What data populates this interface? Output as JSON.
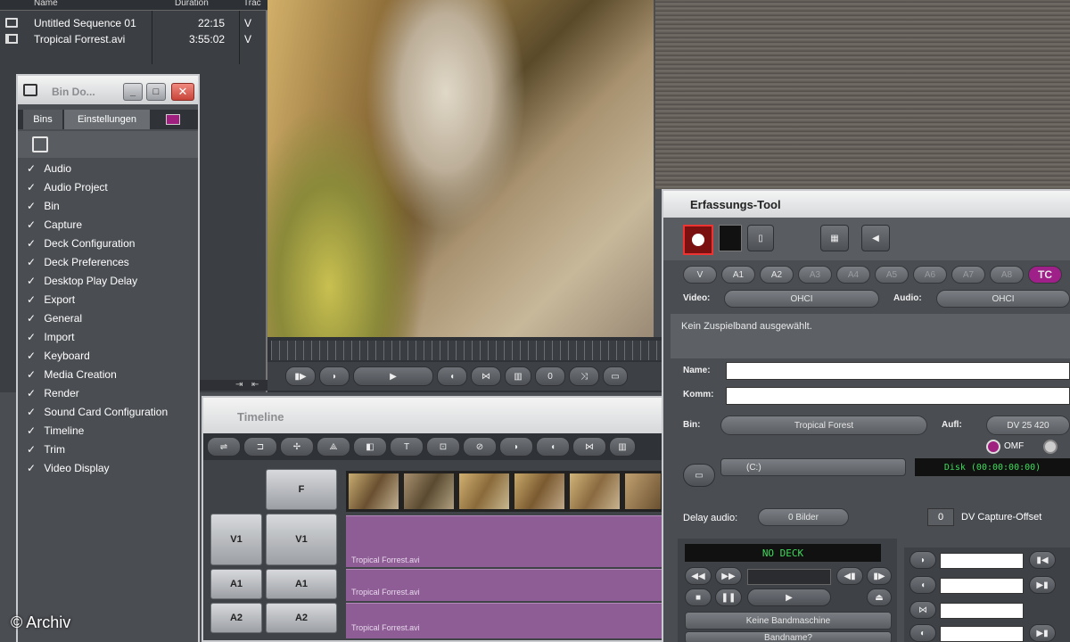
{
  "bin": {
    "col_name": "Name",
    "col_duration": "Duration",
    "col_tracks": "Trac",
    "rows": [
      {
        "name": "Untitled Sequence 01",
        "duration": "22:15",
        "track": "V"
      },
      {
        "name": "Tropical Forrest.avi",
        "duration": "3:55:02",
        "track": "V"
      }
    ]
  },
  "settings": {
    "title": "Bin Do...",
    "tabs": [
      "Bins",
      "Einstellungen"
    ],
    "items": [
      "Audio",
      "Audio Project",
      "Bin",
      "Capture",
      "Deck Configuration",
      "Deck Preferences",
      "Desktop Play Delay",
      "Export",
      "General",
      "Import",
      "Keyboard",
      "Media Creation",
      "Render",
      "Sound Card Configuration",
      "Timeline",
      "Trim",
      "Video Display"
    ]
  },
  "player": {
    "counter": "0"
  },
  "timeline": {
    "title": "Timeline",
    "tracks_src": [
      "V1",
      "A1",
      "A2"
    ],
    "tracks_rec": [
      "V1",
      "A1",
      "A2"
    ],
    "top_label": "F",
    "clip_label": "Tropical Forrest.avi"
  },
  "capture": {
    "title": "Erfassungs-Tool",
    "tracks": [
      "V",
      "A1",
      "A2",
      "A3",
      "A4",
      "A5",
      "A6",
      "A7",
      "A8"
    ],
    "tc": "TC",
    "video_label": "Video:",
    "video_value": "OHCI",
    "audio_label": "Audio:",
    "audio_value": "OHCI",
    "message": "Kein Zuspielband ausgewählt.",
    "name_label": "Name:",
    "comment_label": "Komm:",
    "bin_label": "Bin:",
    "bin_value": "Tropical Forest",
    "res_label": "Aufl:",
    "res_value": "DV 25 420",
    "omf": "OMF",
    "drive": "(C:)",
    "disk": "Disk (00:00:00:00)",
    "delay_label": "Delay audio:",
    "delay_value": "0 Bilder",
    "offset_value": "0",
    "offset_label": "DV Capture-Offset",
    "deck_status": "NO DECK",
    "deck_select": "Keine Bandmaschine",
    "bandname": "Bandname?"
  },
  "credit": "© Archiv",
  "colors": {
    "panel": "#3f4247",
    "purple": "#8e5d96",
    "tc": "#a0208a"
  }
}
